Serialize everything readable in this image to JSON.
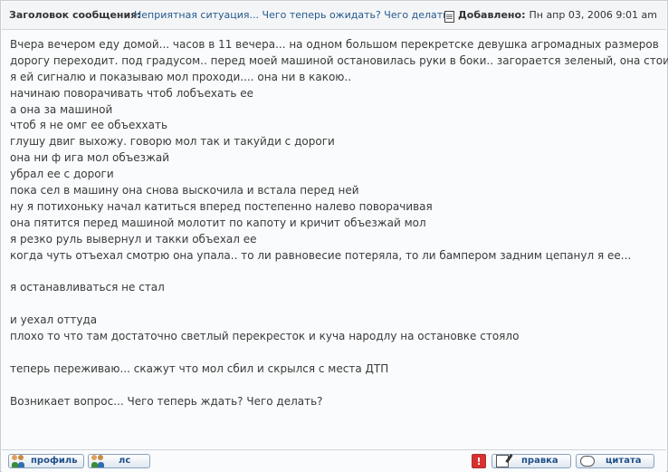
{
  "header": {
    "subject_label": "Заголовок сообщения:",
    "subject": "Неприятная ситуация... Чего теперь ожидать? Чего делать?",
    "added_label": "Добавлено:",
    "date": "Пн апр 03, 2006 9:01 am"
  },
  "body": {
    "lines": [
      "Вчера вечером еду домой... часов в 11 вечера... на одном большом перекретске девушка агромадных размеров",
      "дорогу переходит. под градусом.. перед моей машиной остановилась руки в боки.. загорается зеленый, она стоит..",
      "я ей сигналю и показываю мол проходи.... она ни в какою..",
      "начинаю поворачивать чтоб лобъехать ее",
      "а она за машиной",
      "чтоб я не омг ее объеххать",
      "глушу двиг выхожу. говорю мол так и такуйди с дороги",
      "она ни ф ига мол объезжай",
      "убрал ее с дороги",
      "пока сел в машину она снова выскочила и встала перед ней",
      "ну я потихоньку начал катиться вперед постепенно налево поворачивая",
      "она пятится перед машиной молотит по капоту и кричит объезжай мол",
      "я резко руль вывернул и такки объехал ее",
      "когда чуть отъехал смотрю она упала.. то ли равновесие потеряла, то ли бампером задним цепанул я ее...",
      "",
      "я останавливаться не стал",
      "",
      "и уехал оттуда",
      "плохо то что там достаточно светлый перекресток и куча народлу на остановке стояло",
      "",
      "теперь переживаю... скажут что мол сбил и скрылся с места ДТП",
      "",
      "Возникает вопрос... Чего теперь ждать? Чего делать?"
    ]
  },
  "footer": {
    "profile_label": "профиль",
    "pm_label": "лс",
    "report_label": "!",
    "edit_label": "правка",
    "quote_label": "цитата"
  },
  "icons": {
    "document": "document-icon",
    "users": "users-icon",
    "report": "report-icon",
    "edit": "edit-icon",
    "quote": "quote-icon"
  },
  "colors": {
    "link": "#245a8d",
    "button_text": "#1d4f8a",
    "report": "#d93030"
  }
}
